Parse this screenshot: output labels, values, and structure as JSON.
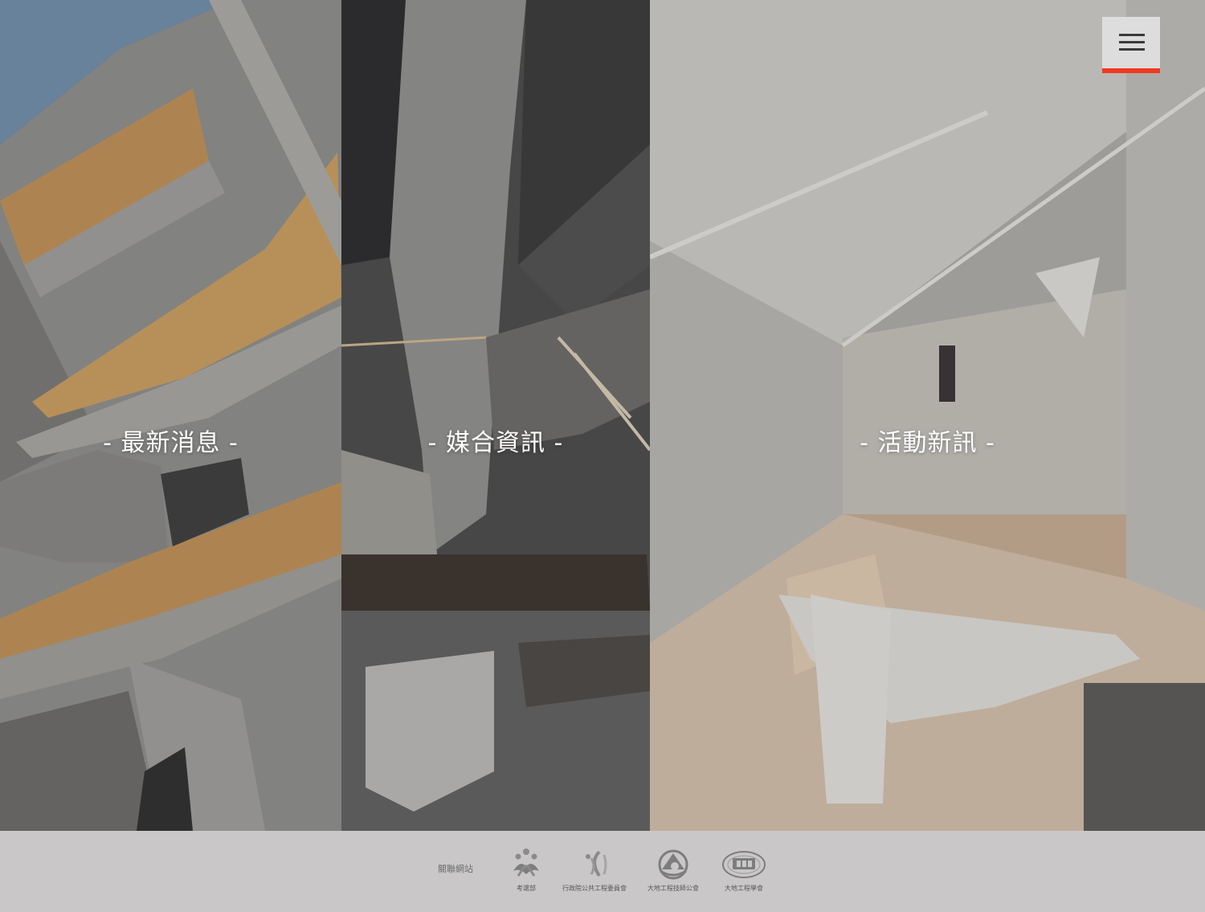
{
  "panels": [
    {
      "title": "- 最新消息 -"
    },
    {
      "title": "- 媒合資訊 -"
    },
    {
      "title": "- 活動新訊 -"
    }
  ],
  "menu": {
    "icon": "hamburger-menu-icon",
    "accent_color": "#ee3a21"
  },
  "footer": {
    "label": "關聯網站",
    "partners": [
      {
        "name": "考選部",
        "icon": "moex-logo-icon"
      },
      {
        "name": "行政院公共工程委員會",
        "icon": "pcc-logo-icon"
      },
      {
        "name": "大地工程技師公會",
        "icon": "geotech-engineers-logo-icon"
      },
      {
        "name": "大地工程學會",
        "icon": "tgs-logo-icon"
      }
    ]
  }
}
